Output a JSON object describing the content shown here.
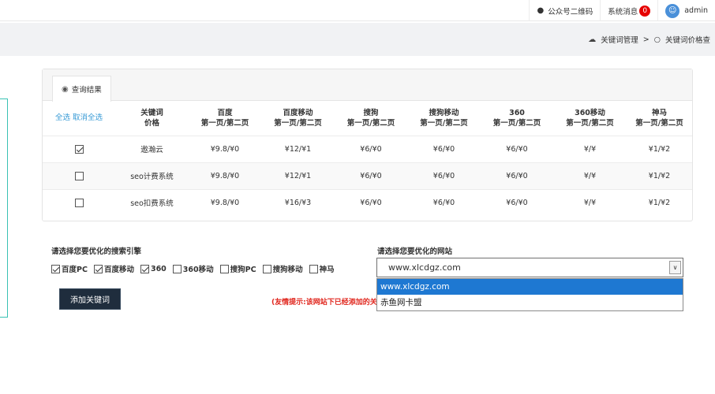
{
  "topbar": {
    "qrcode_label": "公众号二维码",
    "messages_label": "系统消息",
    "messages_count": "0",
    "user_name": "admin"
  },
  "breadcrumb": {
    "parent": "关键词管理",
    "separator": ">",
    "current": "关键词价格查"
  },
  "panel": {
    "tab_label": "查询结果"
  },
  "table": {
    "select_all": "全选",
    "deselect_all": "取消全选",
    "headers": [
      {
        "line1": "关键词",
        "line2": "价格"
      },
      {
        "line1": "百度",
        "line2": "第一页/第二页"
      },
      {
        "line1": "百度移动",
        "line2": "第一页/第二页"
      },
      {
        "line1": "搜狗",
        "line2": "第一页/第二页"
      },
      {
        "line1": "搜狗移动",
        "line2": "第一页/第二页"
      },
      {
        "line1": "360",
        "line2": "第一页/第二页"
      },
      {
        "line1": "360移动",
        "line2": "第一页/第二页"
      },
      {
        "line1": "神马",
        "line2": "第一页/第二页"
      }
    ],
    "rows": [
      {
        "checked": true,
        "cells": [
          "遨瀚云",
          "¥9.8/¥0",
          "¥12/¥1",
          "¥6/¥0",
          "¥6/¥0",
          "¥6/¥0",
          "¥/¥",
          "¥1/¥2"
        ]
      },
      {
        "checked": false,
        "cells": [
          "seo计费系统",
          "¥9.8/¥0",
          "¥12/¥1",
          "¥6/¥0",
          "¥6/¥0",
          "¥6/¥0",
          "¥/¥",
          "¥1/¥2"
        ]
      },
      {
        "checked": false,
        "cells": [
          "seo扣费系统",
          "¥9.8/¥0",
          "¥16/¥3",
          "¥6/¥0",
          "¥6/¥0",
          "¥6/¥0",
          "¥/¥",
          "¥1/¥2"
        ]
      }
    ]
  },
  "engines": {
    "label": "请选择您要优化的搜索引擎",
    "items": [
      {
        "label": "百度PC",
        "checked": true
      },
      {
        "label": "百度移动",
        "checked": true
      },
      {
        "label": "360",
        "checked": true
      },
      {
        "label": "360移动",
        "checked": false
      },
      {
        "label": "搜狗PC",
        "checked": false
      },
      {
        "label": "搜狗移动",
        "checked": false
      },
      {
        "label": "神马",
        "checked": false
      }
    ]
  },
  "site": {
    "label": "请选择您要优化的网站",
    "selected": "www.xlcdgz.com",
    "options": [
      "www.xlcdgz.com",
      "赤鱼网卡盟"
    ]
  },
  "actions": {
    "add_keyword": "添加关键词"
  },
  "tip": "(友情提示:该网站下已经添加的关"
}
